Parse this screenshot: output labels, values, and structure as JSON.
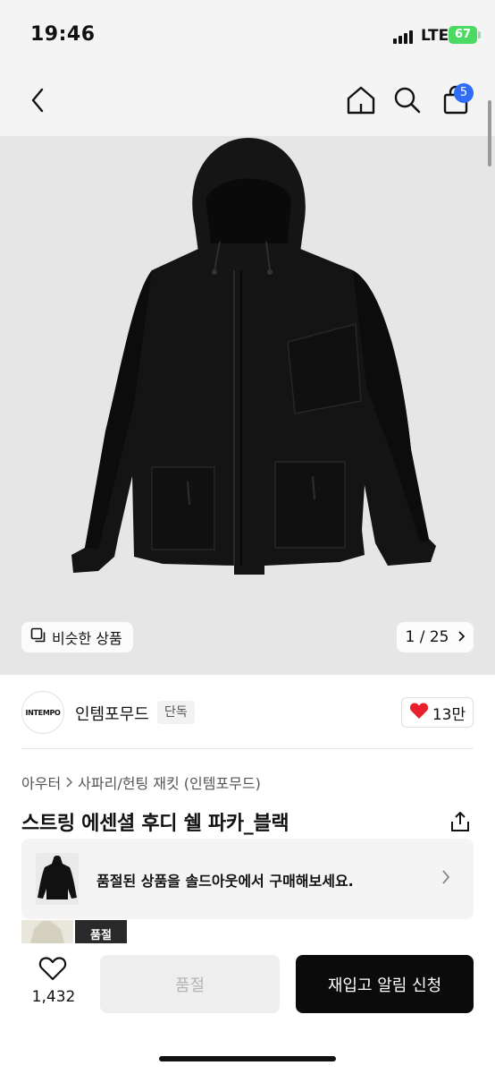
{
  "status_bar": {
    "time": "19:46",
    "network": "LTE",
    "battery": "67"
  },
  "nav": {
    "cart_count": "5"
  },
  "gallery": {
    "similar_label": "비슷한 상품",
    "page_indicator": "1 / 25"
  },
  "brand": {
    "logo_text": "INTEMPO",
    "name": "인템포무드",
    "badge": "단독",
    "likes": "13만"
  },
  "breadcrumb": [
    "아우터",
    "사파리/헌팅 재킷 (인템포무드)"
  ],
  "product": {
    "title": "스트링 에센셜 후디 쉘 파카_블랙"
  },
  "soldout_banner": {
    "text": "품절된 상품을 솔드아웃에서 구매해보세요."
  },
  "thumbnails": {
    "soldout_label": "품절"
  },
  "bottom_bar": {
    "like_count": "1,432",
    "soldout_label": "품절",
    "restock_label": "재입고 알림 신청"
  },
  "colors": {
    "accent_blue": "#2f6df6",
    "battery_green": "#4cd964",
    "heart_red": "#e8202b"
  }
}
